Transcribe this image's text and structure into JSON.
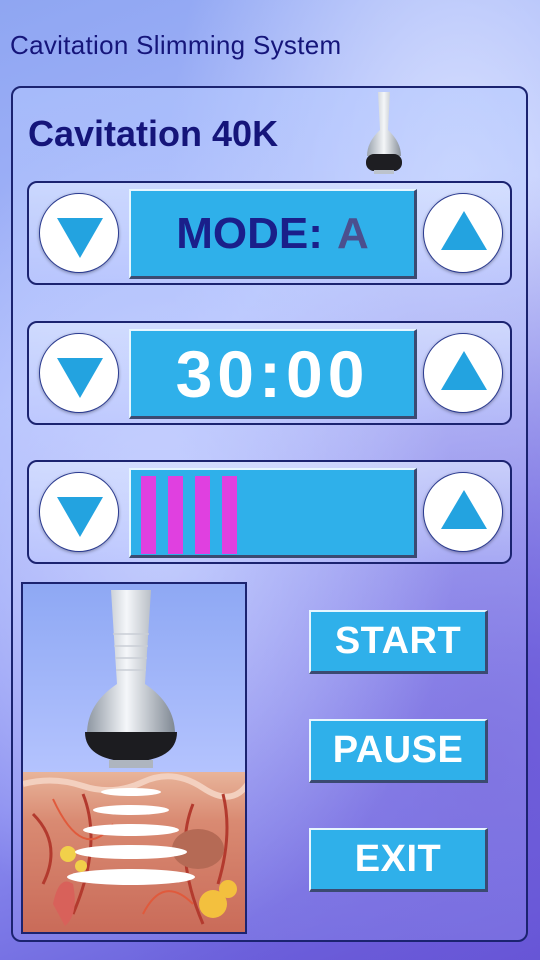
{
  "header": {
    "title": "Cavitation Slimming System"
  },
  "device": {
    "name": "Cavitation 40K"
  },
  "controls": {
    "mode": {
      "label": "MODE:",
      "value": "A"
    },
    "timer": {
      "value": "30:00"
    },
    "intensity": {
      "level": 4
    }
  },
  "actions": {
    "start": "START",
    "pause": "PAUSE",
    "exit": "EXIT"
  },
  "colors": {
    "display_bg": "#2fb0ea",
    "level_bar": "#e040e0",
    "title_text": "#15157a",
    "border": "#1b2370"
  },
  "icons": {
    "decrease": "triangle-down-icon",
    "increase": "triangle-up-icon"
  }
}
